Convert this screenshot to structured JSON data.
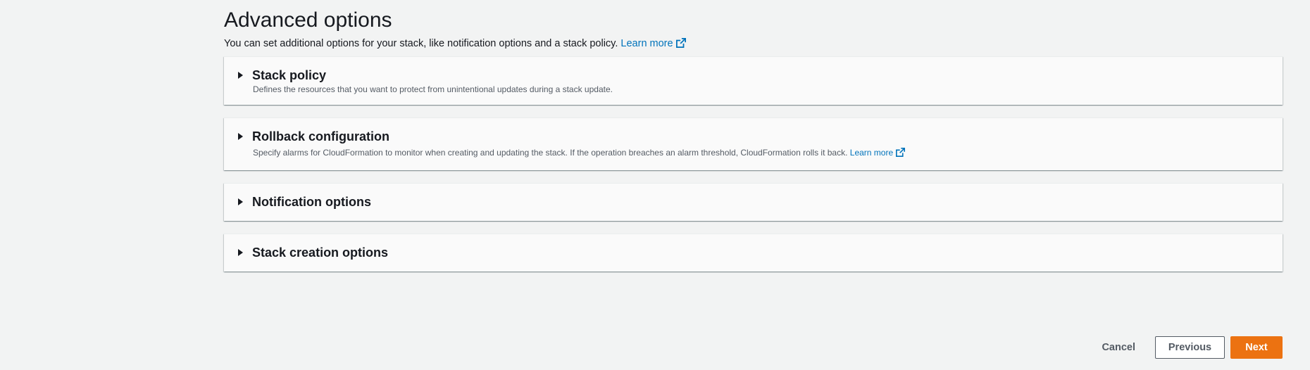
{
  "page": {
    "title": "Advanced options",
    "description": "You can set additional options for your stack, like notification options and a stack policy.",
    "learn_more": "Learn more"
  },
  "panels": [
    {
      "title": "Stack policy",
      "description": "Defines the resources that you want to protect from unintentional updates during a stack update.",
      "expanded": false
    },
    {
      "title": "Rollback configuration",
      "description": "Specify alarms for CloudFormation to monitor when creating and updating the stack. If the operation breaches an alarm threshold, CloudFormation rolls it back.",
      "learn_more": "Learn more",
      "expanded": false
    },
    {
      "title": "Notification options",
      "expanded": false
    },
    {
      "title": "Stack creation options",
      "expanded": false
    }
  ],
  "actions": {
    "cancel": "Cancel",
    "previous": "Previous",
    "next": "Next"
  },
  "colors": {
    "background": "#f2f3f3",
    "panel": "#fafafa",
    "link": "#0073bb",
    "primary": "#ec7211",
    "text": "#16191f",
    "secondary_text": "#545b64"
  },
  "icons": {
    "expand": "caret-right-icon",
    "external_link": "external-link-icon"
  }
}
